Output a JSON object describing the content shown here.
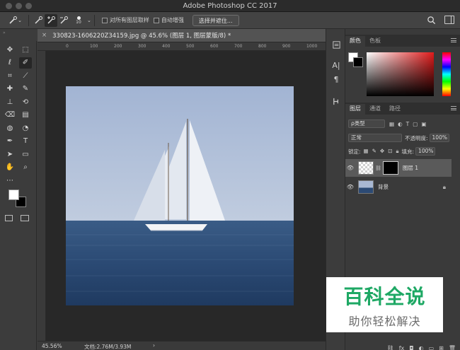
{
  "app": {
    "title": "Adobe Photoshop CC 2017"
  },
  "options_bar": {
    "brush_size": "10",
    "sample_all_layers": "对所有图层取样",
    "auto_enhance": "自动增强",
    "select_and_mask": "选择并遮住..."
  },
  "document": {
    "tab_title": "330823-1606220Z34159.jpg @ 45.6% (图层 1, 图层蒙版/8) *",
    "close_glyph": "×",
    "ruler_ticks": [
      "0",
      "50",
      "100",
      "150",
      "200",
      "250",
      "300",
      "350",
      "400",
      "450",
      "500",
      "550",
      "600",
      "650",
      "700",
      "750",
      "800",
      "850",
      "900",
      "950",
      "1000"
    ]
  },
  "status_bar": {
    "zoom": "45.56%",
    "doc_info": "文档:2.76M/3.93M",
    "arrow": "›"
  },
  "panels": {
    "color_tabs": [
      "颜色",
      "色板"
    ],
    "layer_tabs": [
      "图层",
      "通道",
      "路径"
    ],
    "filter_kind": "ρ类型",
    "blend_mode": "正常",
    "opacity_label": "不透明度:",
    "opacity_value": "100%",
    "lock_label": "锁定:",
    "fill_label": "填充:",
    "fill_value": "100%",
    "layers": [
      {
        "name": "图层 1"
      },
      {
        "name": "背景"
      }
    ],
    "bottom_icons": [
      "link-icon",
      "fx",
      "mask-icon",
      "adjust-icon",
      "folder-icon",
      "new-layer-icon",
      "trash-icon"
    ],
    "fx_label": "fx"
  },
  "watermark": {
    "main": "百科全说",
    "sub": "助你轻松解决"
  },
  "colors": {
    "accent_green": "#1ea864",
    "canvas_bg": "#282828",
    "panel_bg": "#3a3a3a"
  }
}
